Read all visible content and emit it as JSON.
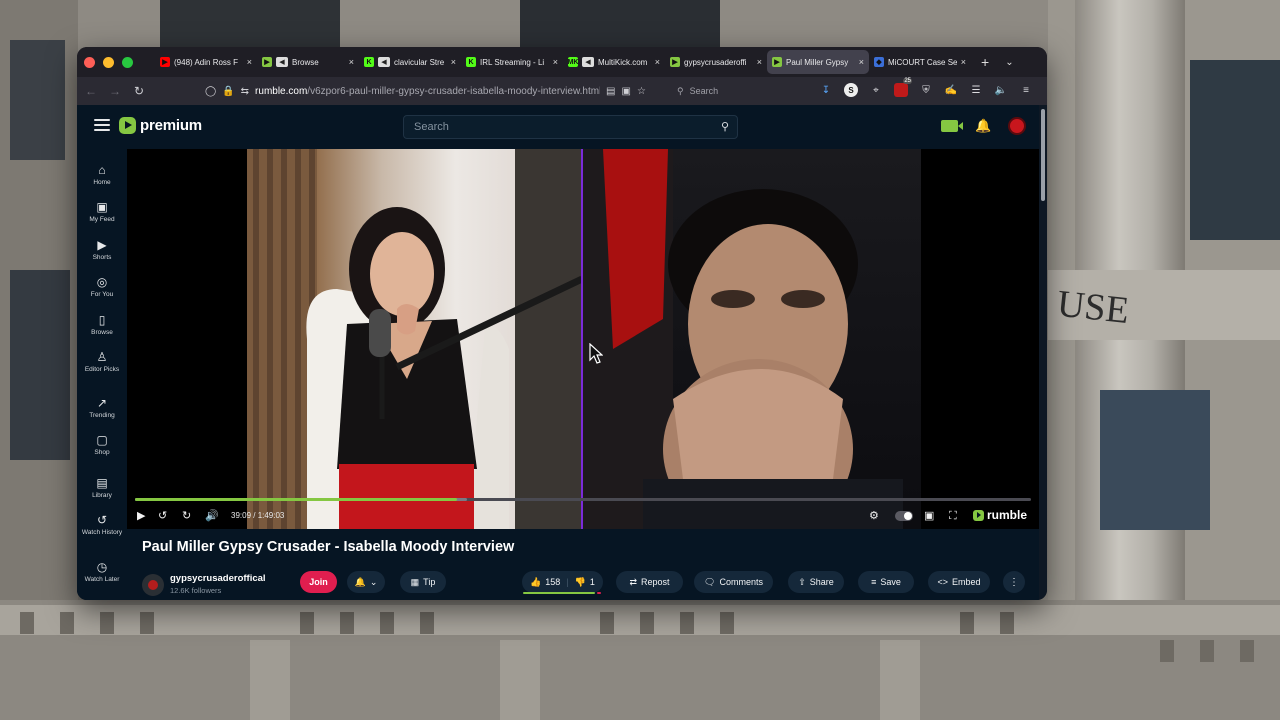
{
  "browser": {
    "tabs": [
      {
        "label": "(948) Adin Ross F",
        "favicon": "youtube",
        "color": "#ff0000",
        "muted": false
      },
      {
        "label": "Browse",
        "favicon": "rumble",
        "color": "#85c742",
        "muted": true
      },
      {
        "label": "clavicular Stre",
        "favicon": "kick",
        "color": "#53fc18",
        "muted": true
      },
      {
        "label": "IRL Streaming - Li",
        "favicon": "kick",
        "color": "#53fc18",
        "muted": false
      },
      {
        "label": "MultiKick.com",
        "favicon": "multikick",
        "color": "#53fc18",
        "muted": true
      },
      {
        "label": "gypsycrusaderoffi",
        "favicon": "rumble",
        "color": "#85c742",
        "muted": false
      },
      {
        "label": "Paul Miller Gypsy",
        "favicon": "rumble",
        "color": "#85c742",
        "muted": false,
        "active": true
      },
      {
        "label": "MiCOURT Case Se",
        "favicon": "micourt",
        "color": "#3b6fd8",
        "muted": false
      }
    ],
    "url_host": "rumble.com",
    "url_path": "/v6zpor6-paul-miller-gypsy-crusader-isabella-moody-interview.html",
    "search_placeholder": "Search",
    "extensions_badge": "25"
  },
  "site": {
    "logo_text": "premium",
    "search_placeholder": "Search",
    "brand_color": "#85c742"
  },
  "sidebar": {
    "items": [
      {
        "label": "Home",
        "icon": "home-icon"
      },
      {
        "label": "My Feed",
        "icon": "feed-icon"
      },
      {
        "label": "Shorts",
        "icon": "shorts-icon"
      },
      {
        "label": "For You",
        "icon": "for-you-icon"
      },
      {
        "label": "Browse",
        "icon": "browse-icon"
      },
      {
        "label": "Editor Picks",
        "icon": "editor-picks-icon"
      },
      {
        "label": "Trending",
        "icon": "trending-icon"
      },
      {
        "label": "Shop",
        "icon": "shop-icon"
      },
      {
        "label": "Library",
        "icon": "library-icon"
      },
      {
        "label": "Watch History",
        "icon": "watch-history-icon"
      },
      {
        "label": "Watch Later",
        "icon": "watch-later-icon"
      }
    ]
  },
  "player": {
    "current_time": "39:09",
    "duration": "1:49:03",
    "time_display": "39:09 / 1:49:03",
    "progress": 0.359,
    "buffered": 0.37,
    "watermark": "rumble"
  },
  "video": {
    "title": "Paul Miller Gypsy Crusader - Isabella Moody Interview",
    "channel_name": "gypsycrusaderoffical",
    "followers": "12.6K followers",
    "join_label": "Join",
    "tip_label": "Tip",
    "likes": "158",
    "dislikes": "1",
    "repost_label": "Repost",
    "comments_label": "Comments",
    "share_label": "Share",
    "save_label": "Save",
    "embed_label": "Embed",
    "like_ratio": 0.9937
  }
}
